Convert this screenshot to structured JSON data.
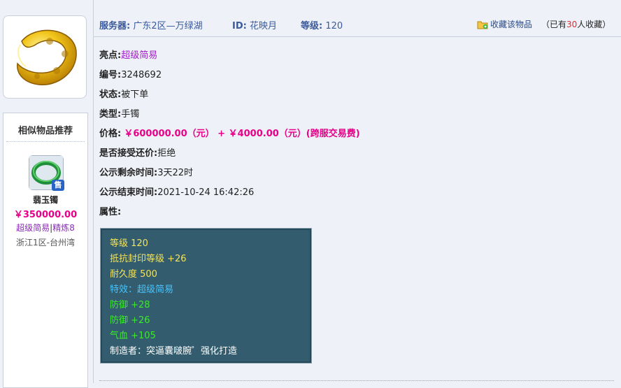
{
  "item": {
    "image_icon": "golden-bracelet-icon"
  },
  "similar": {
    "title": "相似物品推荐",
    "item": {
      "icon": "jade-bracelet-icon",
      "badge": "售",
      "name": "翡玉镯",
      "price": "￥350000.00",
      "tag1": "超级简易",
      "tag_sep": "|",
      "tag2": "精炼8",
      "server": "浙江1区-台州湾"
    }
  },
  "topbar": {
    "server_label": "服务器:",
    "server_value": "广东2区—万绿湖",
    "id_label": "ID:",
    "id_value": "花映月",
    "level_label": "等级:",
    "level_value": "120",
    "fav_button": "收藏该物品",
    "fav_prefix": "（已有",
    "fav_num": "30",
    "fav_suffix": "人收藏）"
  },
  "details": {
    "highlight_label": "亮点:",
    "highlight_value": "超级简易",
    "code_label": "编号:",
    "code_value": "3248692",
    "status_label": "状态:",
    "status_value": "被下单",
    "type_label": "类型:",
    "type_value": "手镯",
    "price_label": "价格:",
    "price_value": "￥600000.00（元） + ￥4000.00（元）(跨服交易费)",
    "bargain_label": "是否接受还价:",
    "bargain_value": "拒绝",
    "remain_label": "公示剩余时间:",
    "remain_value": "3天22时",
    "end_label": "公示结束时间:",
    "end_value": "2021-10-24 16:42:26",
    "attr_label": "属性:"
  },
  "attributes": [
    {
      "text": "等级 120",
      "color": "#f4e35a"
    },
    {
      "text": "抵抗封印等级 +26",
      "color": "#f4e35a"
    },
    {
      "text": "耐久度 500",
      "color": "#f4e35a"
    },
    {
      "text": "特效：超级简易",
      "color": "#45c4ff"
    },
    {
      "text": "防御 +28",
      "color": "#3ee82f"
    },
    {
      "text": "防御 +26",
      "color": "#3ee82f"
    },
    {
      "text": "气血 +105",
      "color": "#3ee82f"
    },
    {
      "text": "制造者：突逼囊啵腕゜强化打造",
      "color": "#ffffff"
    }
  ]
}
